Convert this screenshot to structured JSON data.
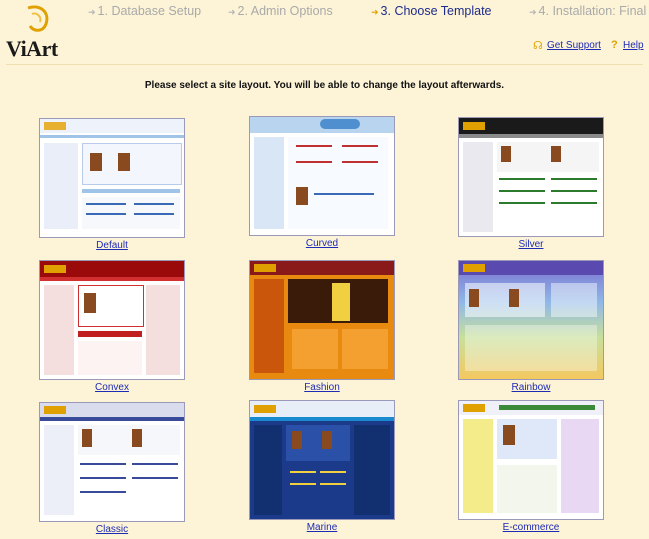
{
  "brand": {
    "name": "ViArt"
  },
  "steps": [
    {
      "label": "1. Database Setup",
      "active": false
    },
    {
      "label": "2. Admin Options",
      "active": false
    },
    {
      "label": "3. Choose Template",
      "active": true
    },
    {
      "label": "4. Installation: Final",
      "active": false
    }
  ],
  "help": {
    "support_label": "Get Support",
    "help_label": "Help"
  },
  "instruction": "Please select a site layout. You will be able to change the layout afterwards.",
  "templates": [
    {
      "name": "Default"
    },
    {
      "name": "Curved"
    },
    {
      "name": "Silver"
    },
    {
      "name": "Convex"
    },
    {
      "name": "Fashion"
    },
    {
      "name": "Rainbow"
    },
    {
      "name": "Classic"
    },
    {
      "name": "Marine"
    },
    {
      "name": "E-commerce"
    }
  ],
  "colors": {
    "background": "#fdf4d8",
    "link": "#1d2bb5",
    "active_step": "#1d2b8a",
    "inactive_step": "#a9a9a9"
  }
}
